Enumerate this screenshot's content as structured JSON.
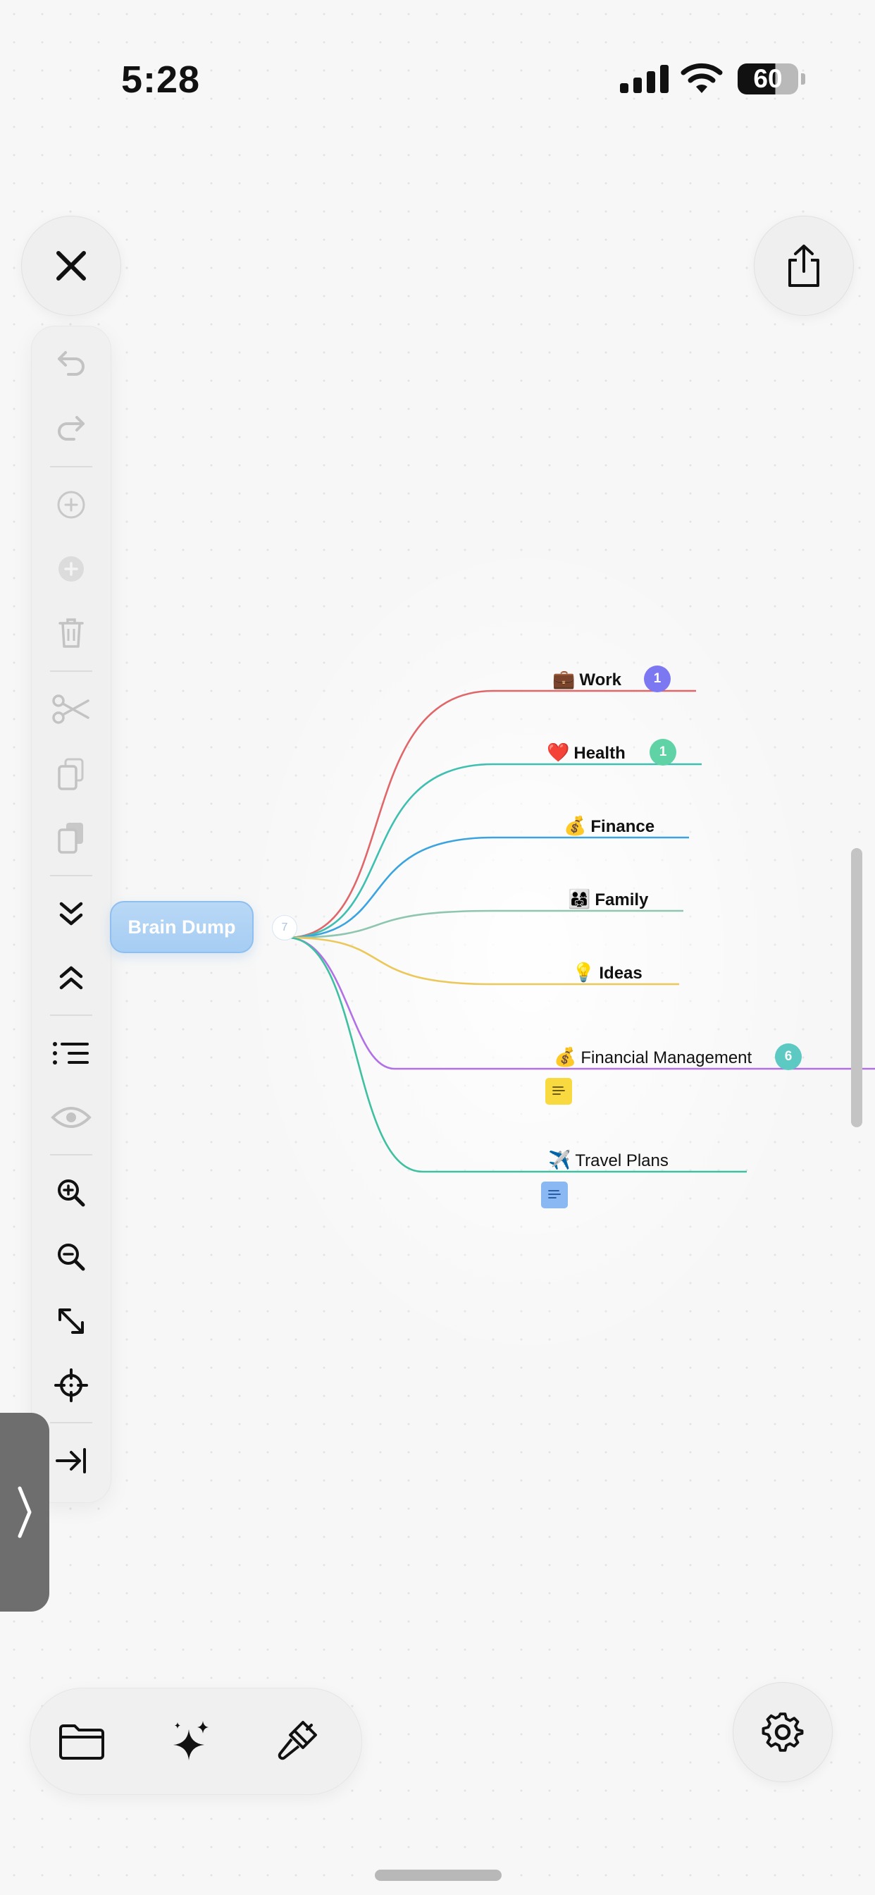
{
  "status_bar": {
    "time": "5:28",
    "battery": "60"
  },
  "mindmap": {
    "root": {
      "label": "Brain Dump",
      "child_count": "7"
    },
    "nodes": [
      {
        "emoji": "💼",
        "label": "Work",
        "badge": "1",
        "badge_color": "#7b78f2",
        "color": "#e0666a"
      },
      {
        "emoji": "❤️",
        "label": "Health",
        "badge": "1",
        "badge_color": "#5fd3a6",
        "color": "#3fbfb0"
      },
      {
        "emoji": "💰",
        "label": "Finance",
        "color": "#3aa3e0"
      },
      {
        "emoji": "👨‍👩‍👧",
        "label": "Family",
        "color": "#8fc6b0"
      },
      {
        "emoji": "💡",
        "label": "Ideas",
        "color": "#ecc85a"
      },
      {
        "emoji": "💰",
        "label": "Financial Management",
        "badge": "6",
        "badge_color": "#5cc9c2",
        "color": "#b270e6",
        "note_color": "#f8d940"
      },
      {
        "emoji": "✈️",
        "label": "Travel Plans",
        "color": "#3fc0a0",
        "note_color": "#8ab8f2"
      }
    ]
  },
  "toolbar": {
    "items": [
      "undo",
      "redo",
      "add-child",
      "add-sibling",
      "delete",
      "cut",
      "copy",
      "paste",
      "expand-all",
      "collapse-all",
      "outline",
      "visibility",
      "zoom-in",
      "zoom-out",
      "fit",
      "center",
      "jump"
    ]
  },
  "colors": {
    "root_fill": "#a6cdf3",
    "toolbar_bg": "#f0f0f0",
    "drawer_tab": "#6e6e6e"
  }
}
